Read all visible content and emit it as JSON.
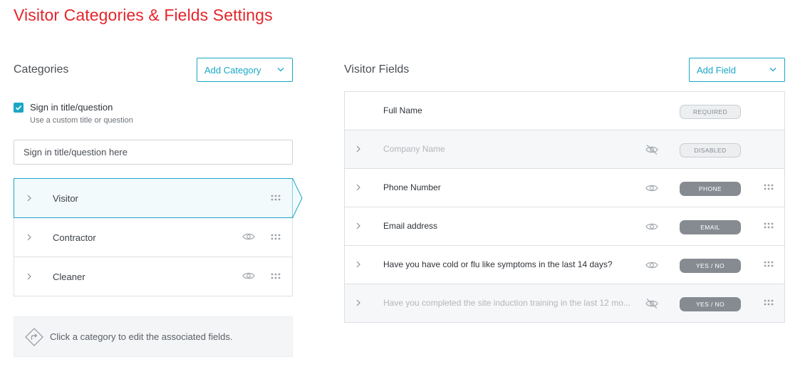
{
  "page": {
    "title": "Visitor Categories & Fields Settings"
  },
  "colors": {
    "brand_red": "#e3262b",
    "accent": "#19a7c4",
    "badge_dark": "#868b91"
  },
  "categories": {
    "heading": "Categories",
    "add_button": "Add Category",
    "sign_in": {
      "checkbox_checked": true,
      "label": "Sign in title/question",
      "help": "Use a custom title or question",
      "input_placeholder": "Sign in title/question here",
      "input_value": ""
    },
    "items": [
      {
        "label": "Visitor",
        "active": true,
        "show_eye": false
      },
      {
        "label": "Contractor",
        "active": false,
        "show_eye": true
      },
      {
        "label": "Cleaner",
        "active": false,
        "show_eye": true
      }
    ],
    "hint": "Click a category to edit the associated fields."
  },
  "fields": {
    "heading": "Visitor Fields",
    "add_button": "Add Field",
    "items": [
      {
        "label": "Full Name",
        "badge": "REQUIRED",
        "badge_style": "light",
        "disabled": false,
        "eye": "none",
        "expandable": false,
        "draggable": false
      },
      {
        "label": "Company Name",
        "badge": "DISABLED",
        "badge_style": "light",
        "disabled": true,
        "eye": "hidden",
        "expandable": true,
        "draggable": false
      },
      {
        "label": "Phone Number",
        "badge": "PHONE",
        "badge_style": "dark",
        "disabled": false,
        "eye": "visible",
        "expandable": true,
        "draggable": true
      },
      {
        "label": "Email address",
        "badge": "EMAIL",
        "badge_style": "dark",
        "disabled": false,
        "eye": "visible",
        "expandable": true,
        "draggable": true
      },
      {
        "label": "Have you have cold or flu like symptoms in the last 14 days?",
        "badge": "YES / NO",
        "badge_style": "dark",
        "disabled": false,
        "eye": "visible",
        "expandable": true,
        "draggable": true
      },
      {
        "label": "Have you completed the site induction training in the last 12 mo...",
        "badge": "YES / NO",
        "badge_style": "dark",
        "disabled": true,
        "eye": "hidden",
        "expandable": true,
        "draggable": true
      }
    ]
  },
  "icons": {
    "checkbox": "check-icon",
    "dropdown": "chevron-down-icon",
    "row_expand": "chevron-right-icon",
    "visibility": "eye-icon",
    "hidden": "eye-off-icon",
    "drag": "drag-handle-icon",
    "hint": "direction-sign-icon"
  }
}
